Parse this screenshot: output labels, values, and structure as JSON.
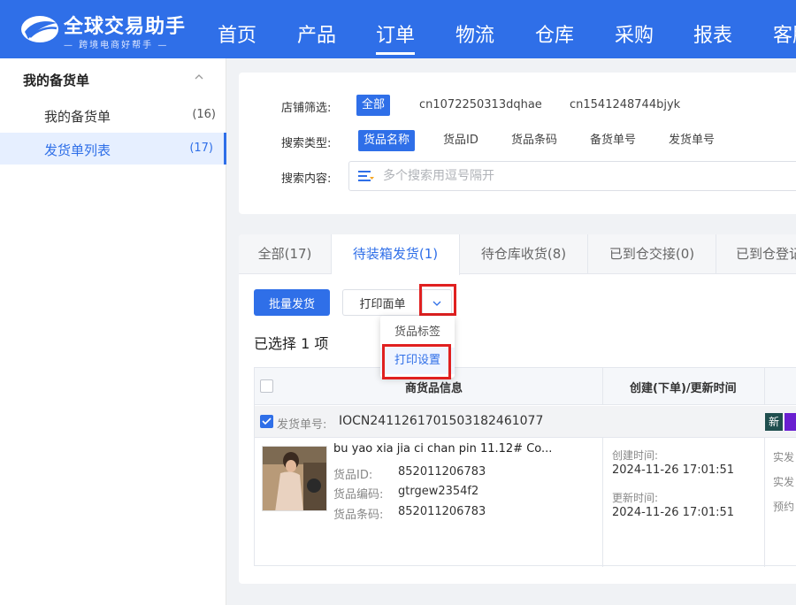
{
  "app": {
    "title": "全球交易助手",
    "subtitle": "— 跨境电商好帮手 —"
  },
  "nav": [
    {
      "label": "首页",
      "active": false
    },
    {
      "label": "产品",
      "active": false
    },
    {
      "label": "订单",
      "active": true
    },
    {
      "label": "物流",
      "active": false
    },
    {
      "label": "仓库",
      "active": false
    },
    {
      "label": "采购",
      "active": false
    },
    {
      "label": "报表",
      "active": false
    },
    {
      "label": "客服",
      "active": false
    }
  ],
  "sidebar": {
    "header": "我的备货单",
    "items": [
      {
        "label": "我的备货单",
        "count": "(16)",
        "active": false
      },
      {
        "label": "发货单列表",
        "count": "(17)",
        "active": true
      }
    ]
  },
  "filters": {
    "store_label": "店铺筛选:",
    "store_options": [
      "全部",
      "cn1072250313dqhae",
      "cn1541248744bjyk"
    ],
    "type_label": "搜索类型:",
    "type_options": [
      "货品名称",
      "货品ID",
      "货品条码",
      "备货单号",
      "发货单号"
    ],
    "content_label": "搜索内容:",
    "search_placeholder": "多个搜索用逗号隔开"
  },
  "tabs": [
    "全部(17)",
    "待装箱发货(1)",
    "待仓库收货(8)",
    "已到仓交接(0)",
    "已到仓登记"
  ],
  "toolbar": {
    "batch_ship": "批量发货",
    "print_label": "打印面单"
  },
  "dropdown": [
    "货品标签",
    "打印设置"
  ],
  "selection_text": "已选择 1 项",
  "table": {
    "headers": [
      "商货品信息",
      "创建(下单)/更新时间"
    ],
    "group": {
      "label": "发货单号:",
      "value": "IOCN2411261701503182461077",
      "badge_new": "新"
    },
    "row": {
      "name": "bu yao xia jia ci chan pin 11.12# Co...",
      "id_label": "货品ID:",
      "id_value": "852011206783",
      "code_label": "货品编码:",
      "code_value": "gtrgew2354f2",
      "barcode_label": "货品条码:",
      "barcode_value": "852011206783",
      "created_label": "创建时间:",
      "created_value": "2024-11-26 17:01:51",
      "updated_label": "更新时间:",
      "updated_value": "2024-11-26 17:01:51",
      "extra": [
        "实发",
        "实发",
        "预约"
      ]
    }
  },
  "colors": {
    "primary": "#2f6fe8",
    "highlight": "#e02020"
  }
}
